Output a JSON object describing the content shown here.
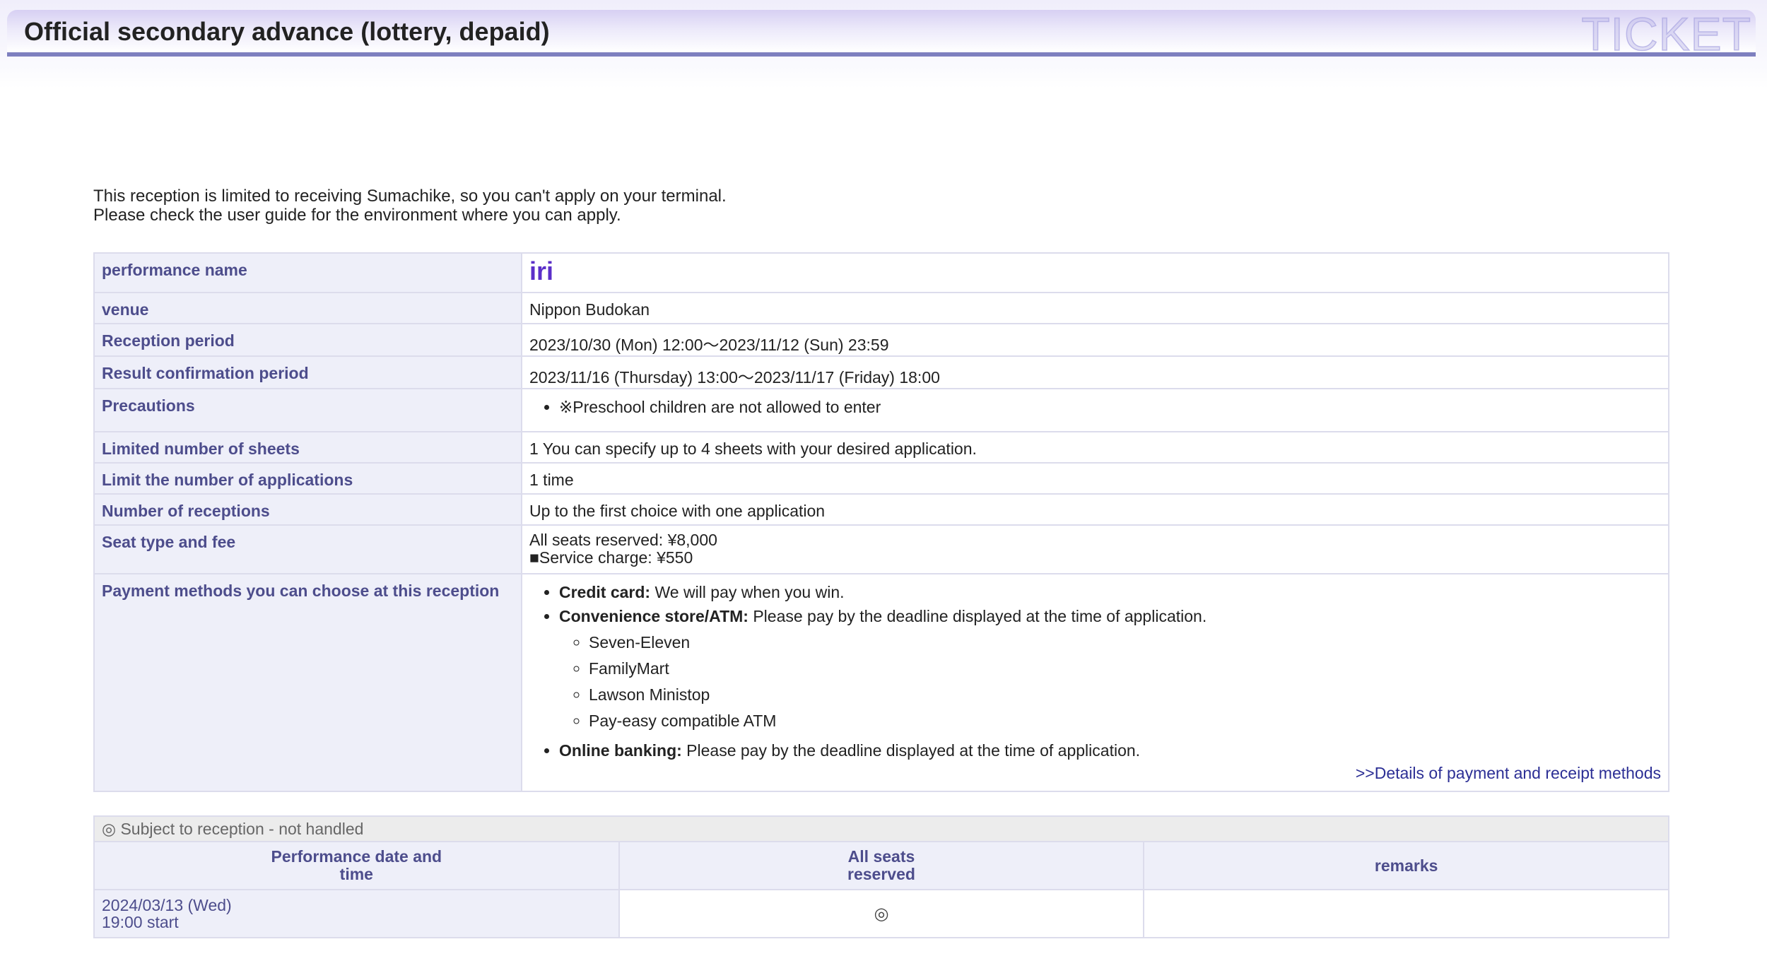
{
  "header": {
    "title": "Official secondary advance (lottery, depaid)",
    "watermark": "TICKET"
  },
  "notice": {
    "line1": "This reception is limited to receiving Sumachike, so you can't apply on your terminal.",
    "line2": "Please check the user guide for the environment where you can apply."
  },
  "info": {
    "performance_name": {
      "label": "performance name",
      "value": "iri"
    },
    "venue": {
      "label": "venue",
      "value": "Nippon Budokan"
    },
    "reception_period": {
      "label": "Reception period",
      "value": "2023/10/30 (Mon) 12:00〜2023/11/12 (Sun) 23:59"
    },
    "result_period": {
      "label": "Result confirmation period",
      "value": "2023/11/16 (Thursday) 13:00〜2023/11/17 (Friday) 18:00"
    },
    "precautions": {
      "label": "Precautions",
      "items": [
        "※Preschool children are not allowed to enter"
      ]
    },
    "limited_sheets": {
      "label": "Limited number of sheets",
      "value": "1 You can specify up to 4 sheets with your desired application."
    },
    "limit_applications": {
      "label": "Limit the number of applications",
      "value": "1 time"
    },
    "number_receptions": {
      "label": "Number of receptions",
      "value": "Up to the first choice with one application"
    },
    "seat_fee": {
      "label": "Seat type and fee",
      "line1": "All seats reserved: ¥8,000",
      "line2": "■Service charge: ¥550"
    },
    "payment": {
      "label": "Payment methods you can choose at this reception",
      "credit_title": "Credit card:",
      "credit_text": " We will pay when you win.",
      "conv_title": "Convenience store/ATM:",
      "conv_text": " Please pay by the deadline displayed at the time of application.",
      "stores": [
        "Seven-Eleven",
        "FamilyMart",
        "Lawson Ministop",
        "Pay-easy compatible ATM"
      ],
      "online_title": "Online banking:",
      "online_text": " Please pay by the deadline displayed at the time of application.",
      "details_link": ">>Details of payment and receipt methods"
    }
  },
  "performances": {
    "legend": "◎ Subject to reception - not handled",
    "columns": {
      "date_line1": "Performance date and",
      "date_line2": "time",
      "seats_line1": "All seats",
      "seats_line2": "reserved",
      "remarks": "remarks"
    },
    "rows": [
      {
        "date": "2024/03/13 (Wed)",
        "time": "19:00 start",
        "availability": "◎",
        "remarks": ""
      }
    ]
  }
}
